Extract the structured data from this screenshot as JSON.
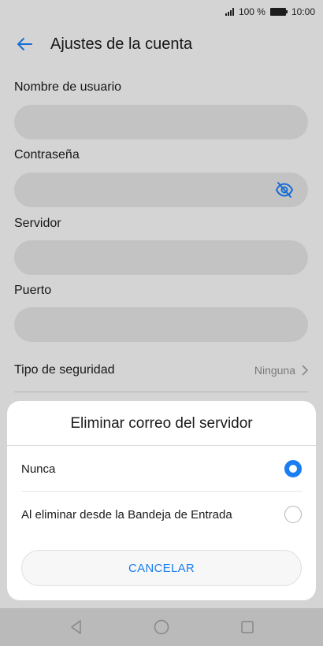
{
  "status_bar": {
    "battery": "100 %",
    "time": "10:00"
  },
  "header": {
    "title": "Ajustes de la cuenta",
    "back_icon": "arrow-left-icon"
  },
  "form": {
    "username_label": "Nombre de usuario",
    "username_value": "",
    "password_label": "Contraseña",
    "password_value": "",
    "password_toggle_icon": "eye-off-icon",
    "server_label": "Servidor",
    "server_value": "",
    "port_label": "Puerto",
    "port_value": "",
    "security_label": "Tipo de seguridad",
    "security_value": "Ninguna"
  },
  "dialog": {
    "title": "Eliminar correo del servidor",
    "options": [
      {
        "label": "Nunca",
        "selected": true
      },
      {
        "label": "Al eliminar desde la Bandeja de Entrada",
        "selected": false
      }
    ],
    "cancel_label": "CANCELAR"
  },
  "colors": {
    "accent": "#1a7ef2",
    "field_bg": "#dedede",
    "background": "#f2f2f2"
  }
}
